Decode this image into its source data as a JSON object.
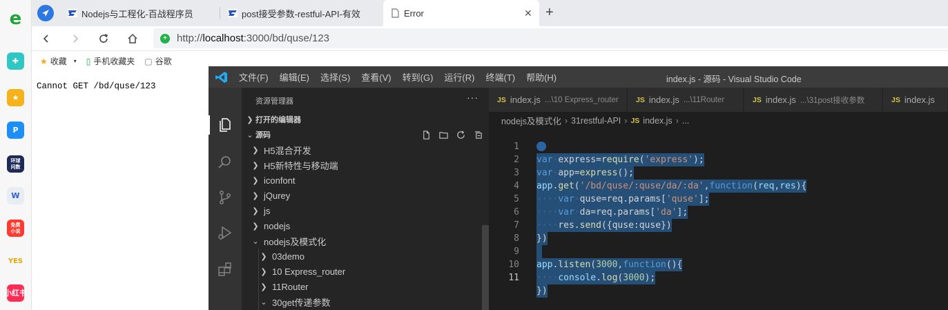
{
  "dock": {
    "items": [
      {
        "name": "edge-logo-icon",
        "glyph": "e",
        "color": "#1fa53a"
      },
      {
        "name": "plus-app-icon",
        "glyph": "✚",
        "color": "#2fc7c6"
      },
      {
        "name": "star-app-icon",
        "glyph": "★",
        "color": "#f6b21a"
      },
      {
        "name": "p-app-icon",
        "glyph": "P",
        "color": "#1b8ff5"
      },
      {
        "name": "globe-app-icon",
        "glyph": "环球\n问数",
        "color": "#1d2a57"
      },
      {
        "name": "w-doc-app-icon",
        "glyph": "W",
        "color": "#e9edf3"
      },
      {
        "name": "novel-app-icon",
        "glyph": "免费\n小说",
        "color": "#ff3a2f"
      },
      {
        "name": "yes-app-icon",
        "glyph": "YES",
        "color": "#f4c430"
      },
      {
        "name": "xiaohongshu-app-icon",
        "glyph": "小红书",
        "color": "#fe2c55"
      }
    ]
  },
  "browser": {
    "tabs": [
      {
        "title": "Nodejs与工程化-百战程序员",
        "active": false
      },
      {
        "title": "post接受参数-restful-API-有效",
        "active": false
      },
      {
        "title": "Error",
        "active": true
      }
    ],
    "close_glyph": "✕",
    "new_tab_glyph": "+",
    "url": {
      "prefix": "http://",
      "host": "localhost",
      "rest": ":3000/bd/quse/123"
    },
    "bookmarks": [
      {
        "label": "收藏",
        "icon": "★"
      },
      {
        "label": "手机收藏夹",
        "icon": "▯"
      },
      {
        "label": "谷歌",
        "icon": "▢"
      }
    ],
    "page_text": "Cannot GET /bd/quse/123"
  },
  "vscode": {
    "menu": [
      "文件(F)",
      "编辑(E)",
      "选择(S)",
      "查看(V)",
      "转到(G)",
      "运行(R)",
      "终端(T)",
      "帮助(H)"
    ],
    "window_title": "index.js - 源码 - Visual Studio Code",
    "sidebar": {
      "title": "资源管理器",
      "more": "···",
      "open_editors": "打开的编辑器",
      "source_section": "源码",
      "folders": [
        "H5混合开发",
        "H5新特性与移动端",
        "iconfont",
        "jQurey",
        "js",
        "nodejs"
      ],
      "expanded_folder": "nodejs及模式化",
      "subfolders": [
        "03demo",
        "10 Express_router",
        "11Router",
        "30get传递参数"
      ]
    },
    "editor_tabs": [
      {
        "name": "index.js",
        "desc": "...\\10 Express_router"
      },
      {
        "name": "index.js",
        "desc": "...\\11Router"
      },
      {
        "name": "index.js",
        "desc": "...\\31post接收参数"
      },
      {
        "name": "index.js",
        "desc": ""
      }
    ],
    "breadcrumb": [
      "nodejs及模式化",
      "31restful-API",
      "index.js",
      "..."
    ],
    "js_badge": "JS",
    "line_numbers": [
      "1",
      "2",
      "3",
      "4",
      "5",
      "6",
      "7",
      "8",
      "9",
      "10",
      "11"
    ],
    "current_line": "11"
  }
}
